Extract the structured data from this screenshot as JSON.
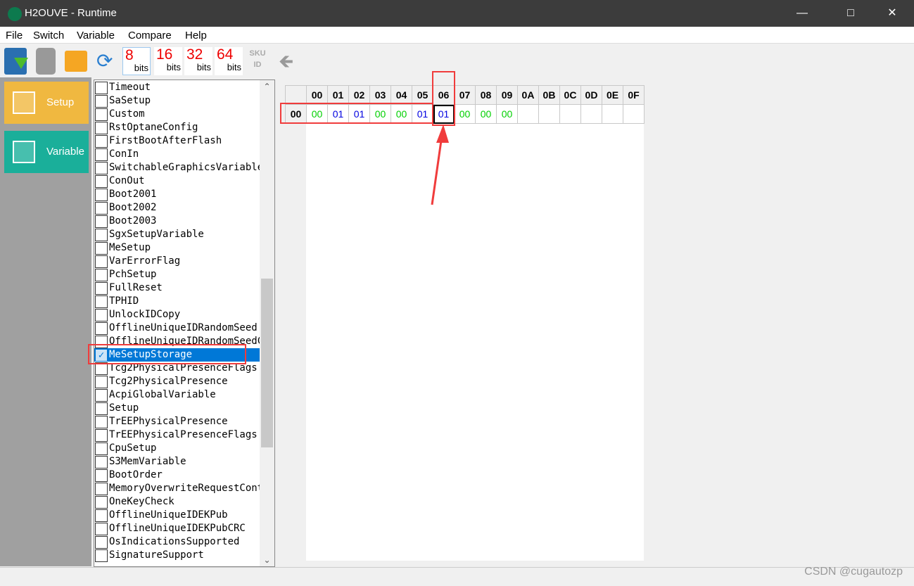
{
  "window": {
    "title": "H2OUVE - Runtime",
    "controls": [
      "minimize",
      "maximize",
      "close"
    ]
  },
  "menu": [
    "File",
    "Switch",
    "Variable",
    "Compare",
    "Help"
  ],
  "toolbar": {
    "icons": [
      "save-icon",
      "disabled-icon",
      "folder-icon",
      "refresh-icon"
    ],
    "bits": [
      {
        "num": "8",
        "unit": "bits",
        "selected": true
      },
      {
        "num": "16",
        "unit": "bits"
      },
      {
        "num": "32",
        "unit": "bits"
      },
      {
        "num": "64",
        "unit": "bits"
      }
    ],
    "sku": "SKU",
    "id": "ID"
  },
  "nav": [
    {
      "label": "Setup",
      "color": "#f0b840"
    },
    {
      "label": "Variable",
      "color": "#1aaf9a"
    }
  ],
  "variables": [
    "Timeout",
    "SaSetup",
    "Custom",
    "RstOptaneConfig",
    "FirstBootAfterFlash",
    "ConIn",
    "SwitchableGraphicsVariable",
    "ConOut",
    "Boot2001",
    "Boot2002",
    "Boot2003",
    "SgxSetupVariable",
    "MeSetup",
    "VarErrorFlag",
    "PchSetup",
    "FullReset",
    "TPHID",
    "UnlockIDCopy",
    "OfflineUniqueIDRandomSeed",
    "OfflineUniqueIDRandomSeedCRC",
    "MeSetupStorage",
    "Tcg2PhysicalPresenceFlags",
    "Tcg2PhysicalPresence",
    "AcpiGlobalVariable",
    "Setup",
    "TrEEPhysicalPresence",
    "TrEEPhysicalPresenceFlags",
    "CpuSetup",
    "S3MemVariable",
    "BootOrder",
    "MemoryOverwriteRequestControl",
    "OneKeyCheck",
    "OfflineUniqueIDEKPub",
    "OfflineUniqueIDEKPubCRC",
    "OsIndicationsSupported",
    "SignatureSupport"
  ],
  "selected_variable": "MeSetupStorage",
  "grid": {
    "columns": [
      "00",
      "01",
      "02",
      "03",
      "04",
      "05",
      "06",
      "07",
      "08",
      "09",
      "0A",
      "0B",
      "0C",
      "0D",
      "0E",
      "0F"
    ],
    "rows": [
      {
        "label": "00",
        "values": [
          "00",
          "01",
          "01",
          "00",
          "00",
          "01",
          "01",
          "00",
          "00",
          "00",
          "",
          "",
          "",
          "",
          "",
          ""
        ]
      }
    ],
    "selected_column": "06"
  },
  "watermark": "CSDN @cugautozp"
}
